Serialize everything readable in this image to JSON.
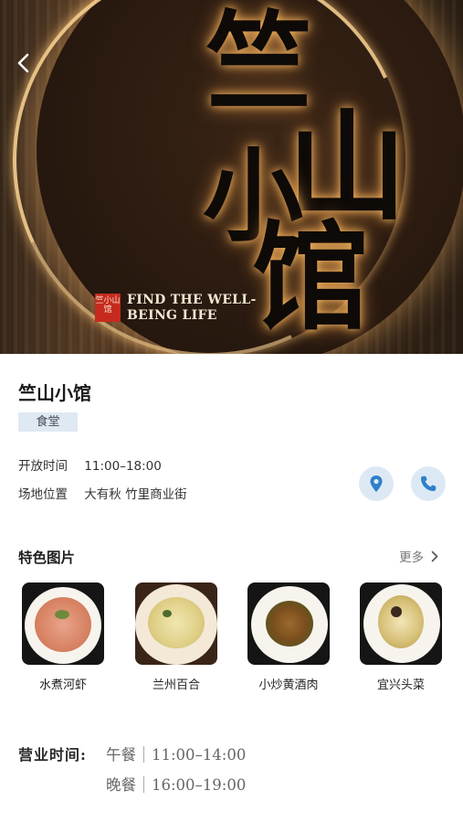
{
  "hero": {
    "sign_chars": [
      "竺",
      "山",
      "小",
      "馆"
    ],
    "seal_text": "竺小山馆",
    "slogan_line1": "FIND THE WELL-",
    "slogan_line2": "BEING LIFE",
    "back_icon": "chevron-left-icon"
  },
  "venue": {
    "name": "竺山小馆",
    "tag": "食堂",
    "open_label": "开放时间",
    "open_value": "11:00–18:00",
    "location_label": "场地位置",
    "location_value": "大有秋 竹里商业街",
    "location_icon": "map-pin-icon",
    "phone_icon": "phone-icon",
    "accent_color": "#2f7fc9"
  },
  "gallery": {
    "title": "特色图片",
    "more_label": "更多",
    "items": [
      {
        "name": "水煮河虾"
      },
      {
        "name": "兰州百合"
      },
      {
        "name": "小炒黄酒肉"
      },
      {
        "name": "宜兴头菜"
      }
    ]
  },
  "hours": {
    "label": "营业时间:",
    "lunch_name": "午餐",
    "lunch_time": "11:00–14:00",
    "dinner_name": "晚餐",
    "dinner_time": "16:00–19:00"
  }
}
